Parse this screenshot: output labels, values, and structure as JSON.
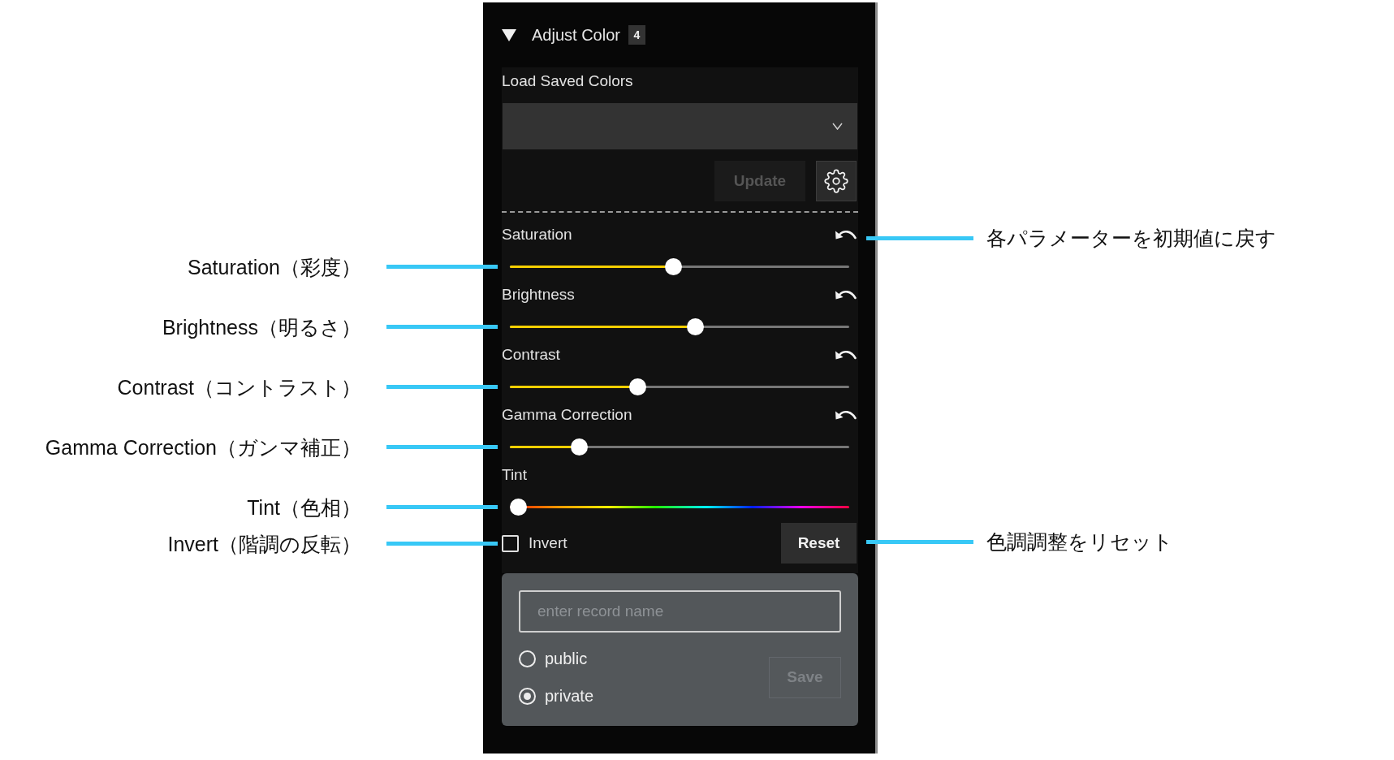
{
  "header": {
    "title": "Adjust Color",
    "badge": "4",
    "expanded": true
  },
  "load_saved_colors": {
    "label": "Load Saved Colors",
    "update_button": {
      "label": "Update",
      "disabled": true
    }
  },
  "sliders": [
    {
      "label": "Saturation",
      "kind": "level",
      "level": 0.48
    },
    {
      "label": "Brightness",
      "kind": "level",
      "level": 0.55
    },
    {
      "label": "Contrast",
      "kind": "level",
      "level": 0.37
    },
    {
      "label": "Gamma Correction",
      "kind": "level",
      "level": 0.19
    },
    {
      "label": "Tint",
      "kind": "hue",
      "level": 0
    }
  ],
  "invert": {
    "label": "Invert",
    "checked": false
  },
  "reset_button": {
    "label": "Reset"
  },
  "save_form": {
    "record_name": {
      "placeholder": "enter record name"
    },
    "visibility": [
      {
        "label": "public",
        "selected": false
      },
      {
        "label": "private",
        "selected": true
      }
    ],
    "save_button": {
      "label": "Save",
      "disabled": true
    }
  },
  "annotations": {
    "left": [
      {
        "text": "Saturation（彩度）"
      },
      {
        "text": "Brightness（明るさ）"
      },
      {
        "text": "Contrast（コントラスト）"
      },
      {
        "text": "Gamma Correction（ガンマ補正）"
      },
      {
        "text": "Tint（色相）"
      },
      {
        "text": "Invert（階調の反転）"
      }
    ],
    "right": [
      {
        "text": "各パラメーターを初期値に戻す"
      },
      {
        "text": "色調調整をリセット"
      }
    ]
  }
}
